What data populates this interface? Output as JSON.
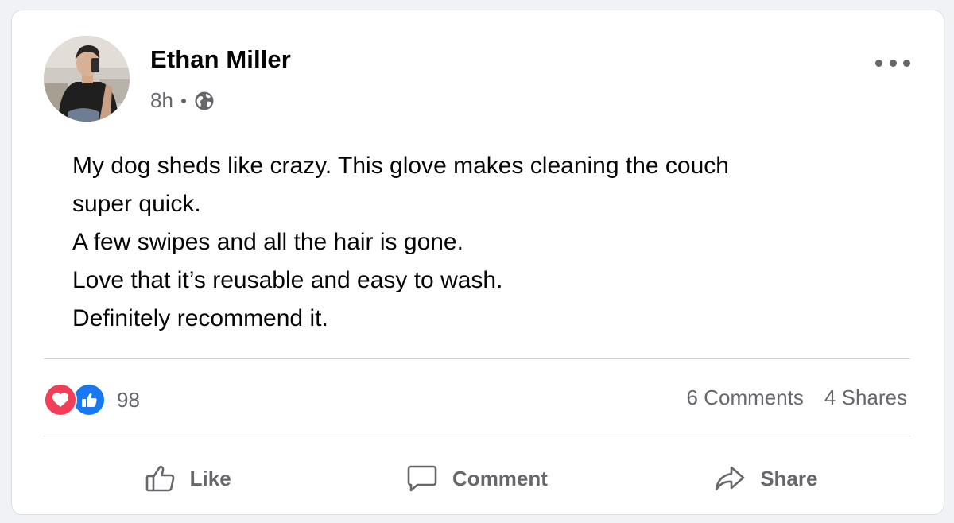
{
  "post": {
    "author": "Ethan Miller",
    "time": "8h",
    "audience_icon": "globe-icon",
    "text_lines": [
      "My dog sheds like crazy. This glove makes cleaning the couch",
      "super quick.",
      "A few swipes and all the hair is gone.",
      "Love that it’s reusable and easy to wash.",
      "Definitely recommend it."
    ]
  },
  "reactions": {
    "icons": [
      "love-reaction-icon",
      "like-reaction-icon"
    ],
    "count": "98"
  },
  "stats": {
    "comments": "6 Comments",
    "shares": "4 Shares"
  },
  "actions": {
    "like": "Like",
    "comment": "Comment",
    "share": "Share"
  },
  "colors": {
    "text": "#050505",
    "secondary_text": "#65676b",
    "love": "#f33e58",
    "like": "#1877f2",
    "divider": "#ced0d4"
  }
}
